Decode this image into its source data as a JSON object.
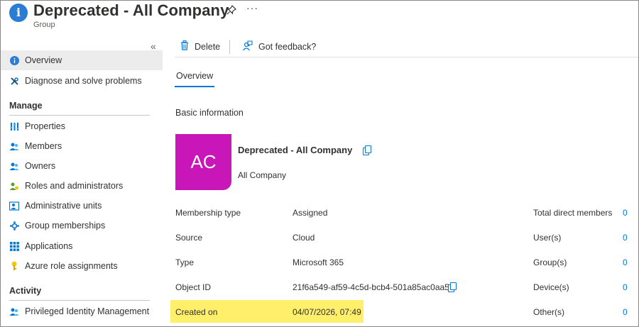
{
  "header": {
    "title": "Deprecated - All Company",
    "subtitle": "Group",
    "pin_icon": "pin-icon",
    "more_label": "···"
  },
  "sidebar": {
    "collapse_label": "«",
    "items": [
      {
        "label": "Overview",
        "icon": "info-icon"
      },
      {
        "label": "Diagnose and solve problems",
        "icon": "wrench-icon"
      }
    ],
    "manage_heading": "Manage",
    "manage_items": [
      {
        "label": "Properties",
        "icon": "properties-icon"
      },
      {
        "label": "Members",
        "icon": "members-icon"
      },
      {
        "label": "Owners",
        "icon": "owners-icon"
      },
      {
        "label": "Roles and administrators",
        "icon": "roles-icon"
      },
      {
        "label": "Administrative units",
        "icon": "admin-units-icon"
      },
      {
        "label": "Group memberships",
        "icon": "group-memberships-icon"
      },
      {
        "label": "Applications",
        "icon": "applications-icon"
      },
      {
        "label": "Azure role assignments",
        "icon": "key-icon"
      }
    ],
    "activity_heading": "Activity",
    "activity_items": [
      {
        "label": "Privileged Identity Management",
        "icon": "pim-icon"
      }
    ]
  },
  "toolbar": {
    "delete_label": "Delete",
    "feedback_label": "Got feedback?"
  },
  "tabs": {
    "overview": "Overview"
  },
  "basic": {
    "heading": "Basic information",
    "avatar_initials": "AC",
    "group_name": "Deprecated - All Company",
    "group_description": "All Company",
    "accent_color": "#c916b8"
  },
  "properties": [
    {
      "label": "Membership type",
      "value": "Assigned"
    },
    {
      "label": "Source",
      "value": "Cloud"
    },
    {
      "label": "Type",
      "value": "Microsoft 365"
    },
    {
      "label": "Object ID",
      "value": "21f6a549-af59-4c5d-bcb4-501a85ac0aa5"
    },
    {
      "label": "Created on",
      "value": "04/07/2026, 07:49"
    }
  ],
  "stats": [
    {
      "label": "Total direct members",
      "value": "0"
    },
    {
      "label": "User(s)",
      "value": "0"
    },
    {
      "label": "Group(s)",
      "value": "0"
    },
    {
      "label": "Device(s)",
      "value": "0"
    },
    {
      "label": "Other(s)",
      "value": "0"
    }
  ]
}
